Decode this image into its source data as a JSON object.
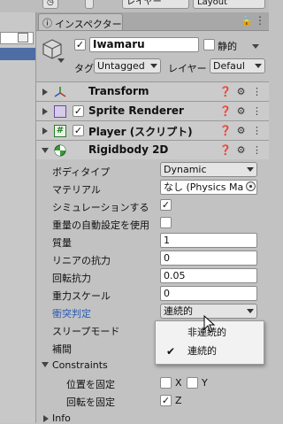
{
  "toolbar": {
    "layer_label": "レイヤー",
    "layout_label": "Layout"
  },
  "inspector": {
    "tab_title": "インスペクター",
    "object_name": "Iwamaru",
    "active": true,
    "static_label": "静的",
    "static_checked": false,
    "tag_label": "タグ",
    "tag_value": "Untagged",
    "layer_label": "レイヤー",
    "layer_value": "Defaul"
  },
  "components": [
    {
      "name": "Transform",
      "expanded": false,
      "has_toggle": false
    },
    {
      "name": "Sprite Renderer",
      "expanded": false,
      "has_toggle": true
    },
    {
      "name": "Player (スクリプト)",
      "expanded": false,
      "has_toggle": true
    },
    {
      "name": "Rigidbody 2D",
      "expanded": true,
      "has_toggle": false
    }
  ],
  "rigidbody": {
    "body_type_label": "ボディタイプ",
    "body_type_value": "Dynamic",
    "material_label": "マテリアル",
    "material_value": "なし (Physics Ma",
    "simulated_label": "シミュレーションする",
    "simulated_checked": true,
    "auto_mass_label": "重量の自動設定を使用",
    "auto_mass_checked": false,
    "mass_label": "質量",
    "mass_value": "1",
    "linear_drag_label": "リニアの抗力",
    "linear_drag_value": "0",
    "angular_drag_label": "回転抗力",
    "angular_drag_value": "0.05",
    "gravity_scale_label": "重力スケール",
    "gravity_scale_value": "0",
    "collision_label": "衝突判定",
    "collision_value": "連続的",
    "sleep_label": "スリープモード",
    "interp_label": "補間",
    "constraints_label": "Constraints",
    "freeze_pos_label": "位置を固定",
    "freeze_pos_x": false,
    "freeze_pos_y": false,
    "freeze_rot_label": "回転を固定",
    "freeze_rot_z": true,
    "x_label": "X",
    "y_label": "Y",
    "z_label": "Z"
  },
  "info_label": "Info",
  "collision_popup": {
    "options": [
      {
        "label": "非連続的",
        "selected": false
      },
      {
        "label": "連続的",
        "selected": true
      }
    ]
  },
  "colors": {
    "selection": "#4f6da5",
    "label_highlight": "#2a5bb5",
    "panel_bg": "#c2c2c2"
  }
}
